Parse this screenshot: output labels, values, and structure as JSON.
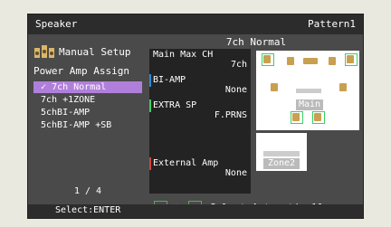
{
  "header": {
    "title": "Speaker",
    "pattern_label": "Pattern1"
  },
  "left": {
    "setup_label": "Manual Setup",
    "section_label": "Power Amp Assign",
    "items": [
      {
        "label": "7ch Normal",
        "selected": true
      },
      {
        "label": "7ch +1ZONE",
        "selected": false
      },
      {
        "label": "5chBI-AMP",
        "selected": false
      },
      {
        "label": "5chBI-AMP +SB",
        "selected": false
      }
    ],
    "pager": "1 / 4"
  },
  "mode": {
    "title": "7ch Normal",
    "rows": [
      {
        "key": "Main Max CH",
        "value": "7ch",
        "color": ""
      },
      {
        "key": "BI-AMP",
        "value": "None",
        "color": "#2d8bd8"
      },
      {
        "key": "EXTRA SP",
        "value": "F.PRNS",
        "color": "#3ccf66"
      },
      {
        "key": "External Amp",
        "value": "None",
        "color": "#d94040"
      }
    ],
    "main_label": "Main",
    "zone2_label": "Zone2"
  },
  "auto": {
    "label": "Select Automatically"
  },
  "footer": {
    "hint": "Select:ENTER"
  },
  "icons": {
    "speaker": "speaker-icon",
    "arrows": "arrows-icon"
  }
}
